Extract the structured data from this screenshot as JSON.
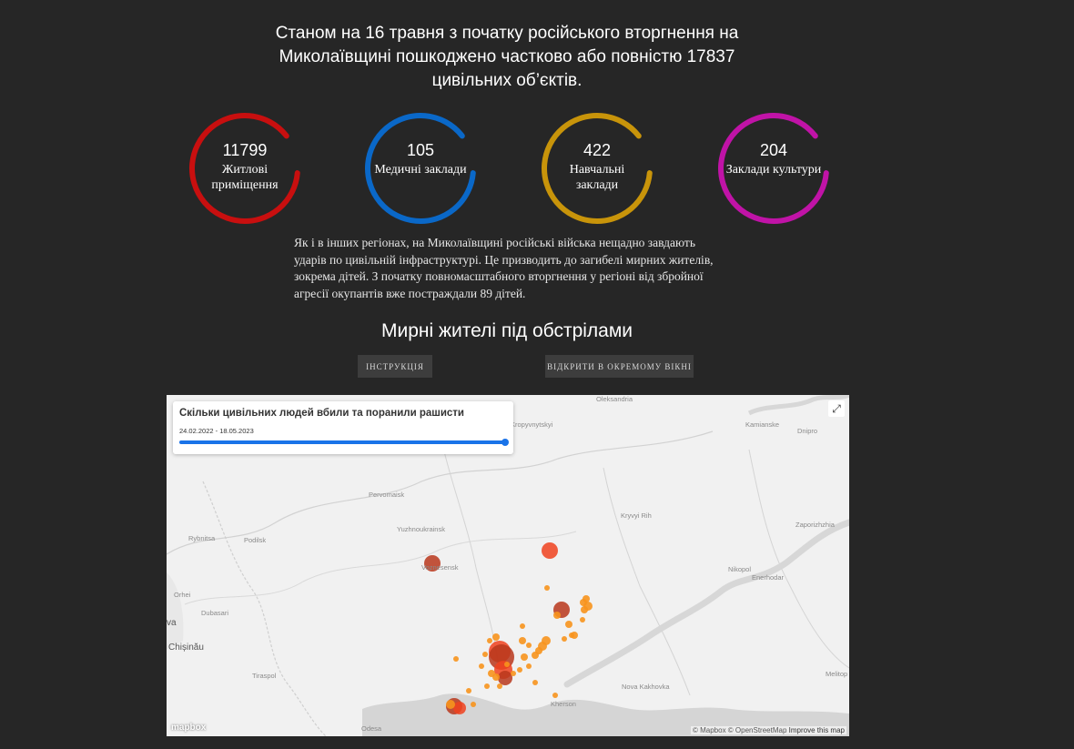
{
  "headline": "Станом на 16 травня з початку російського вторгнення на Миколаївщині пошкоджено частково або повністю 17837 цивільних об’єктів.",
  "stats": [
    {
      "value": "11799",
      "label": "Житлові приміщення",
      "color": "#c80f0f",
      "ratio": 0.88
    },
    {
      "value": "105",
      "label": "Медичні заклади",
      "color": "#0a68c8",
      "ratio": 0.88
    },
    {
      "value": "422",
      "label": "Навчальні заклади",
      "color": "#c8940a",
      "ratio": 0.88
    },
    {
      "value": "204",
      "label": "Заклади культури",
      "color": "#c013a7",
      "ratio": 0.88
    }
  ],
  "body_text": "Як і в інших регіонах, на Миколаївщині російські війська нещадно завдають ударів по цивільній інфраструктурі. Це призводить до загибелі мирних жителів, зокрема дітей. З початку повномасштабного вторгнення у регіоні від збройної агресії окупантів вже постраждали 89 дітей.",
  "section_title": "Мирні жителі під обстрілами",
  "buttons": {
    "instructions": "ІНСТРУКЦІЯ",
    "open_window": "ВІДКРИТИ В ОКРЕМОМУ ВІКНІ"
  },
  "map": {
    "card_title": "Скільки цивільних людей вбили та поранили рашисти",
    "date_range": "24.02.2022 - 18.05.2023",
    "fullscreen_icon": "expand-icon",
    "logo": "mapbox",
    "attribution": "© Mapbox © OpenStreetMap",
    "improve": "Improve this map",
    "places": [
      {
        "name": "Oleksandria"
      },
      {
        "name": "Kropyvnytskyi"
      },
      {
        "name": "Kamianske"
      },
      {
        "name": "Dnipro"
      },
      {
        "name": "Pervomaisk"
      },
      {
        "name": "Kryvyi Rih"
      },
      {
        "name": "Yuzhnoukrainsk"
      },
      {
        "name": "Zaporizhzhia"
      },
      {
        "name": "Rybnitsa"
      },
      {
        "name": "Podilsk"
      },
      {
        "name": "Voznesensk"
      },
      {
        "name": "Nikopol"
      },
      {
        "name": "Enerhodar"
      },
      {
        "name": "Orhei"
      },
      {
        "name": "Dubasari"
      },
      {
        "name": "va"
      },
      {
        "name": "Chișinău"
      },
      {
        "name": "Tiraspol"
      },
      {
        "name": "Kherson"
      },
      {
        "name": "Nova Kakhovka"
      },
      {
        "name": "Melitop"
      },
      {
        "name": "Odesa"
      }
    ],
    "colors": {
      "dark": "#b9371c",
      "red": "#f0421e",
      "orange": "#f7941d"
    }
  }
}
